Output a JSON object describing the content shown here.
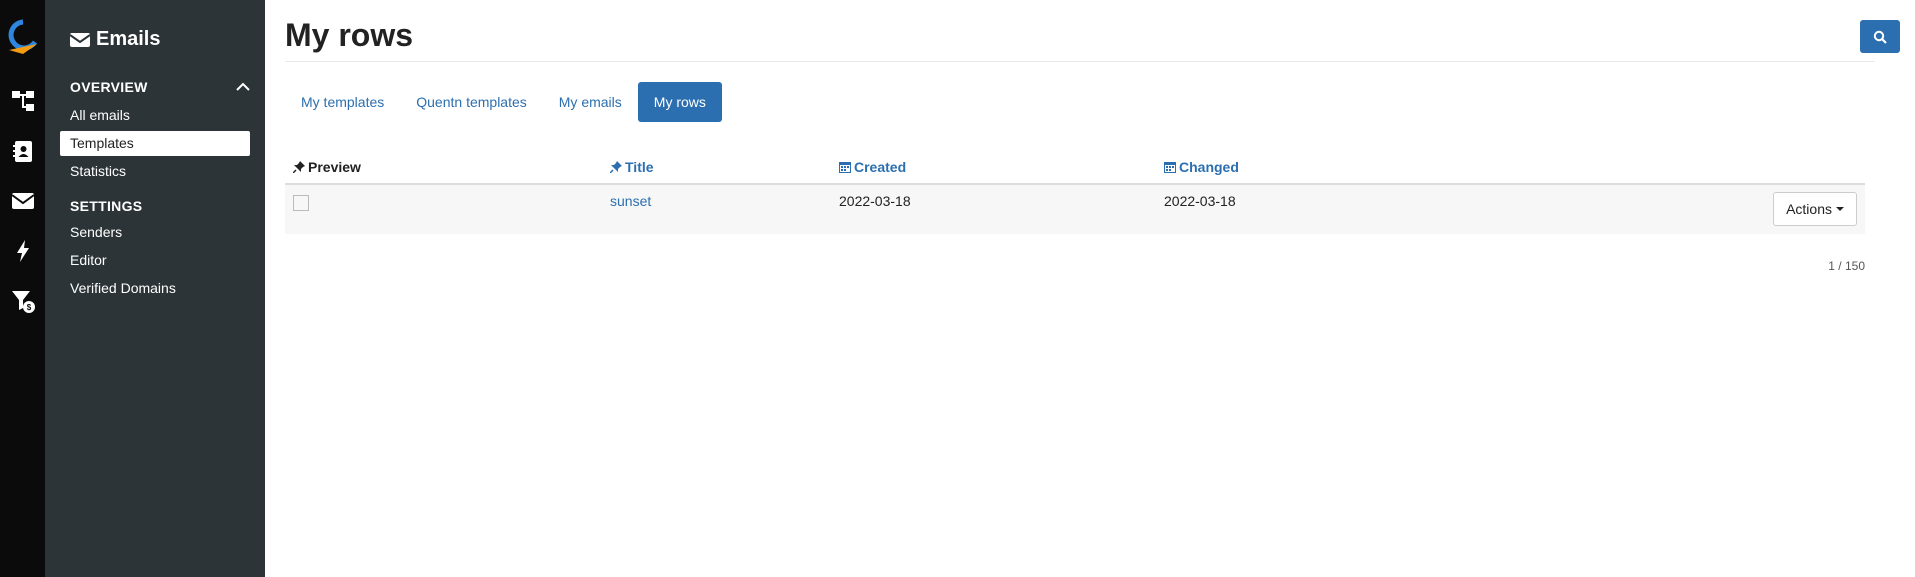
{
  "rail": {
    "items": [
      {
        "icon": "flow-icon"
      },
      {
        "icon": "contacts-icon"
      },
      {
        "icon": "envelope-icon"
      },
      {
        "icon": "lightning-icon"
      },
      {
        "icon": "filter-dollar-icon"
      }
    ]
  },
  "sidebar": {
    "title": "Emails",
    "overview_label": "OVERVIEW",
    "overview_items": [
      {
        "label": "All emails"
      },
      {
        "label": "Templates"
      },
      {
        "label": "Statistics"
      }
    ],
    "settings_label": "SETTINGS",
    "settings_items": [
      {
        "label": "Senders"
      },
      {
        "label": "Editor"
      },
      {
        "label": "Verified Domains"
      }
    ]
  },
  "main": {
    "title": "My rows",
    "tabs": [
      {
        "label": "My templates"
      },
      {
        "label": "Quentn templates"
      },
      {
        "label": "My emails"
      },
      {
        "label": "My rows"
      }
    ],
    "columns": {
      "preview": "Preview",
      "title": "Title",
      "created": "Created",
      "changed": "Changed"
    },
    "rows": [
      {
        "title": "sunset",
        "created": "2022-03-18",
        "changed": "2022-03-18",
        "actions_label": "Actions"
      }
    ],
    "pagination": "1 / 150"
  },
  "colors": {
    "accent": "#2c6fb0",
    "sidebar_bg": "#2c3438",
    "rail_bg": "#0b0b0b"
  }
}
